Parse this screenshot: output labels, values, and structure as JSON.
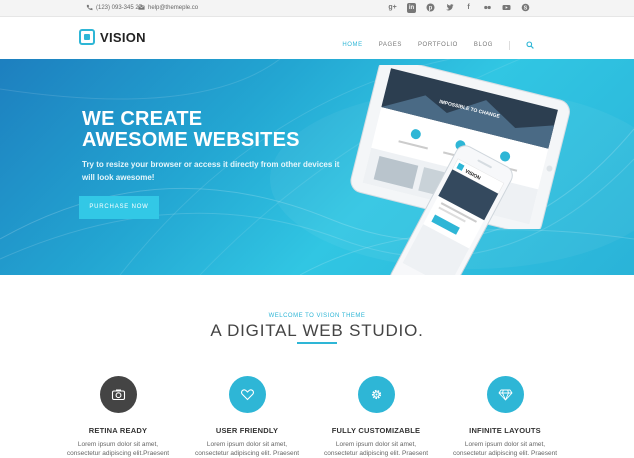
{
  "topbar": {
    "phone": "(123) 093-345 27",
    "email": "help@themeple.co",
    "social_icons": [
      "google-plus-icon",
      "linkedin-icon",
      "pinterest-icon",
      "twitter-icon",
      "facebook-icon",
      "flickr-icon",
      "youtube-icon",
      "skype-icon"
    ]
  },
  "header": {
    "logo_text": "VISION",
    "nav": [
      "HOME",
      "PAGES",
      "PORTFOLIO",
      "BLOG"
    ],
    "active_nav": "HOME",
    "accent": "#2eb6d6"
  },
  "hero": {
    "title_line1": "WE CREATE",
    "title_line2": "AWESOME WEBSITES",
    "subtitle": "Try to resize your browser or access it directly from other devices it will look awesome!",
    "button": "PURCHASE NOW",
    "tablet_banner": "IMPOSSIBLE TO CHANGE",
    "phone_logo": "VISION"
  },
  "section": {
    "kicker": "WELCOME TO VISION THEME",
    "title": "A DIGITAL WEB STUDIO.",
    "features": [
      {
        "title": "RETINA READY",
        "desc1": "Lorem ipsum dolor sit amet,",
        "desc2": "consectetur adipiscing elit.Praesent",
        "icon": "camera-icon"
      },
      {
        "title": "USER FRIENDLY",
        "desc1": "Lorem ipsum dolor sit amet,",
        "desc2": "consectetur adipiscing elit. Praesent",
        "icon": "heart-icon"
      },
      {
        "title": "FULLY CUSTOMIZABLE",
        "desc1": "Lorem ipsum dolor sit amet,",
        "desc2": "consectetur adipiscing elit. Praesent",
        "icon": "gear-icon"
      },
      {
        "title": "INFINITE LAYOUTS",
        "desc1": "Lorem ipsum dolor sit amet,",
        "desc2": "consectetur adipiscing elit. Praesent",
        "icon": "diamond-icon"
      }
    ]
  }
}
